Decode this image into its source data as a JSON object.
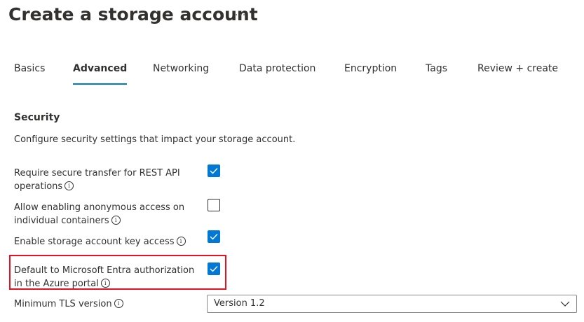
{
  "header": {
    "title": "Create a storage account",
    "more": "···"
  },
  "tabs": [
    {
      "label": "Basics",
      "active": false
    },
    {
      "label": "Advanced",
      "active": true
    },
    {
      "label": "Networking",
      "active": false
    },
    {
      "label": "Data protection",
      "active": false
    },
    {
      "label": "Encryption",
      "active": false
    },
    {
      "label": "Tags",
      "active": false
    },
    {
      "label": "Review + create",
      "active": false
    }
  ],
  "security": {
    "title": "Security",
    "description": "Configure security settings that impact your storage account.",
    "settings": [
      {
        "label": "Require secure transfer for REST API operations",
        "checked": true
      },
      {
        "label": "Allow enabling anonymous access on individual containers",
        "checked": false
      },
      {
        "label": "Enable storage account key access",
        "checked": true
      },
      {
        "label": "Default to Microsoft Entra authorization in the Azure portal",
        "checked": true
      }
    ],
    "tls": {
      "label": "Minimum TLS version",
      "value": "Version 1.2"
    }
  },
  "icons": {
    "info": "info-icon",
    "check": "checkmark-icon",
    "chevron": "chevron-down-icon"
  },
  "colors": {
    "accent": "#0078d4",
    "highlight": "#e81123",
    "text": "#323130"
  }
}
